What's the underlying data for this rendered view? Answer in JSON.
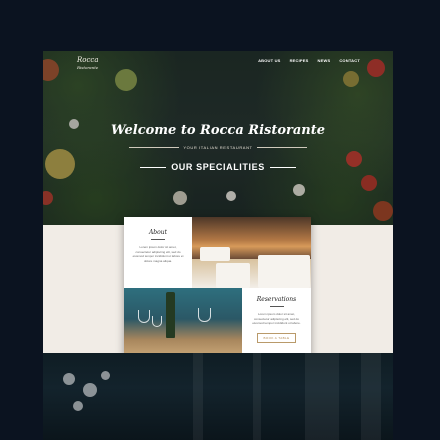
{
  "logo": {
    "name": "Rocca",
    "sub": "Ristorante"
  },
  "nav": [
    "ABOUT US",
    "RECIPES",
    "NEWS",
    "CONTACT"
  ],
  "hero": {
    "title": "Welcome to Rocca Ristorante",
    "tagline": "YOUR ITALIAN RESTAURANT"
  },
  "about": {
    "heading": "About",
    "body": "Lorem ipsum dolor sit amet, consectetur adipiscing elit, sed do eiusmod tempor incididunt ut labore et dolore magna aliqua."
  },
  "reservations": {
    "heading": "Reservations",
    "body": "Lorem ipsum dolor sit amet, consectetur adipiscing elit, sed do eiusmod tempor incididunt ut labore.",
    "button": "BOOK A TABLE"
  },
  "specialities": {
    "title": "OUR SPECIALITIES"
  },
  "colors": {
    "accent": "#b08a55",
    "cream": "#f1ece6",
    "dark": "#0e1a1f"
  }
}
